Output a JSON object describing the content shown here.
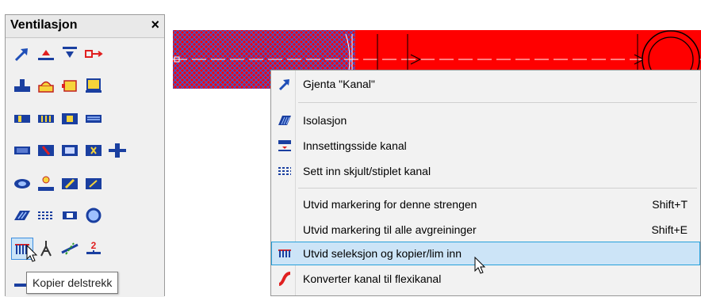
{
  "palette": {
    "title": "Ventilasjon",
    "close_glyph": "×",
    "tooltip": "Kopier delstrekk"
  },
  "menu": {
    "items": [
      {
        "label": "Gjenta \"Kanal\"",
        "shortcut": "",
        "icon": "repeat-arrow-icon"
      },
      {
        "label": "Isolasjon",
        "shortcut": "",
        "icon": "insulation-hatch-icon"
      },
      {
        "label": "Innsettingsside kanal",
        "shortcut": "",
        "icon": "insert-side-icon"
      },
      {
        "label": "Sett inn skjult/stiplet kanal",
        "shortcut": "",
        "icon": "dashed-duct-icon"
      },
      {
        "label": "Utvid markering for denne strengen",
        "shortcut": "Shift+T",
        "icon": ""
      },
      {
        "label": "Utvid markering til alle avgreininger",
        "shortcut": "Shift+E",
        "icon": ""
      },
      {
        "label": "Utvid seleksjon og kopier/lim inn",
        "shortcut": "",
        "icon": "branch-copy-icon"
      },
      {
        "label": "Konverter kanal til flexikanal",
        "shortcut": "",
        "icon": "flex-duct-icon"
      }
    ]
  },
  "colors": {
    "duct_red": "#ff0000",
    "hatch_blue": "#3a5bd8",
    "menu_highlight": "#cce4f7"
  }
}
